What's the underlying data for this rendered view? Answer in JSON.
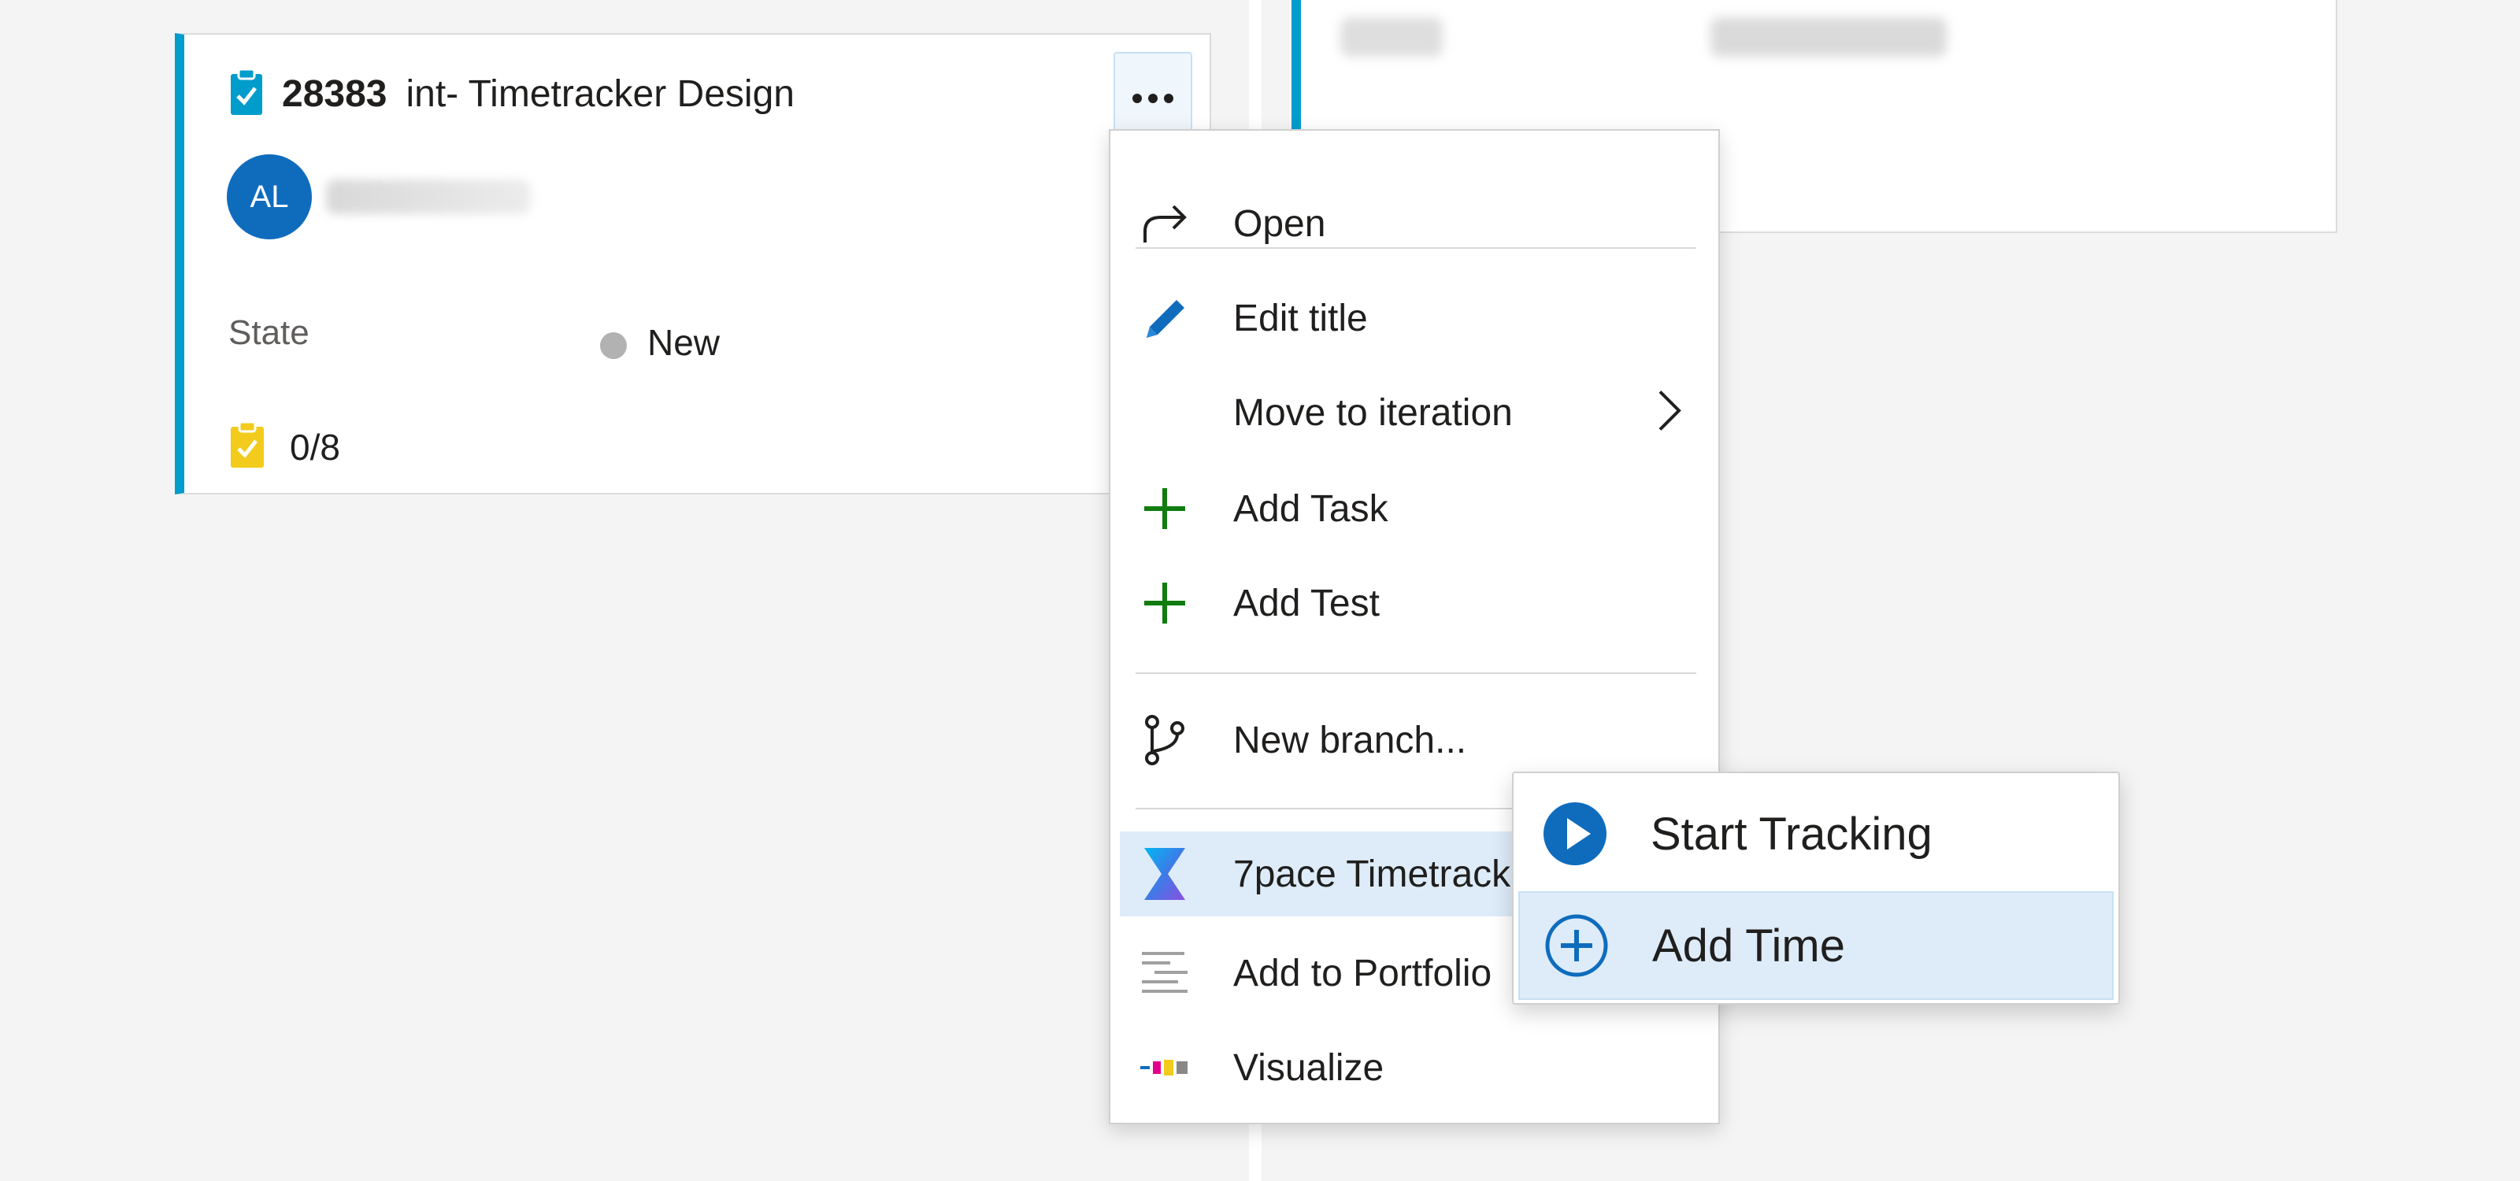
{
  "card": {
    "id": "28383",
    "title": "int- Timetracker Design",
    "avatar_initials": "AL",
    "state_label": "State",
    "state_value": "New",
    "tasks_progress": "0/8"
  },
  "menu": {
    "items": [
      {
        "label": "Open",
        "icon": "open-arrow-icon"
      },
      {
        "label": "Edit title",
        "icon": "pencil-icon"
      },
      {
        "label": "Move to iteration",
        "icon": "none"
      },
      {
        "label": "Add Task",
        "icon": "plus-icon"
      },
      {
        "label": "Add Test",
        "icon": "plus-icon"
      },
      {
        "label": "New branch...",
        "icon": "branch-icon"
      },
      {
        "label": "7pace Timetrack",
        "icon": "7pace-logo-icon"
      },
      {
        "label": "Add to Portfolio",
        "icon": "portfolio-icon"
      },
      {
        "label": "Visualize",
        "icon": "visualize-icon"
      }
    ]
  },
  "submenu": {
    "items": [
      {
        "label": "Start Tracking",
        "icon": "play-circle-icon"
      },
      {
        "label": "Add Time",
        "icon": "plus-circle-icon"
      }
    ]
  },
  "colors": {
    "accent": "#009ccc",
    "avatar": "#0f6cbd",
    "plus_green": "#107c10",
    "highlight": "#deecf9",
    "task_yellow": "#f2cb1d"
  }
}
